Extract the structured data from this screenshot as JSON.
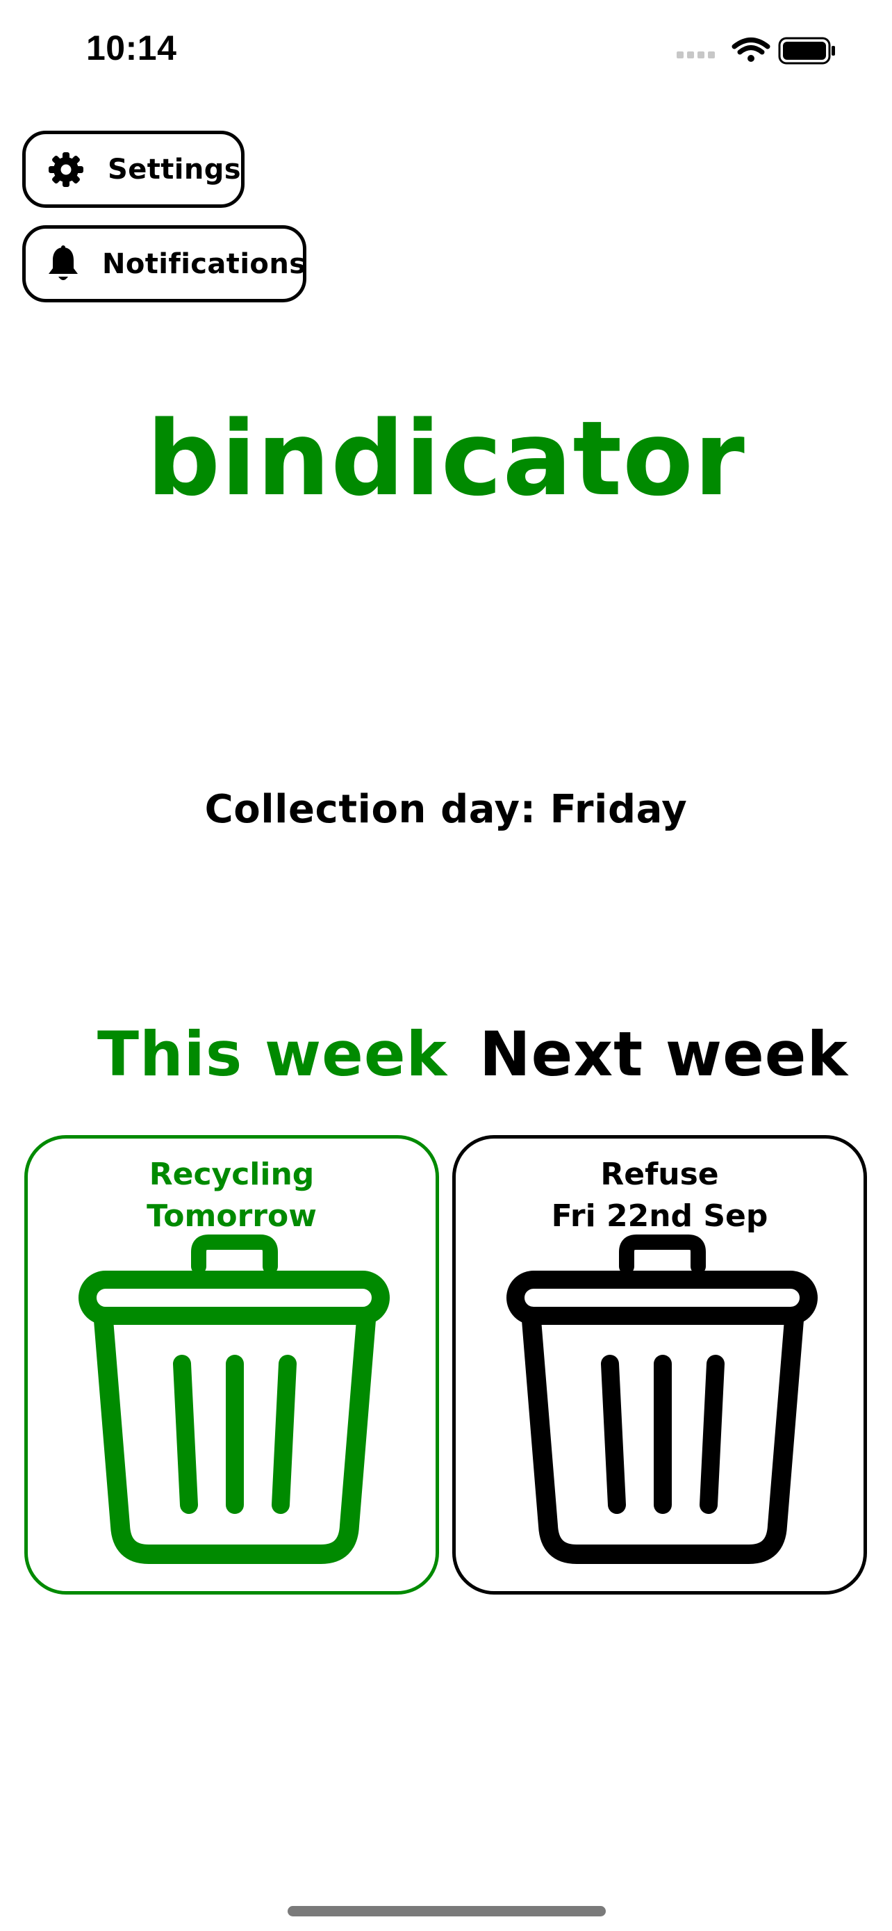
{
  "status_bar": {
    "time": "10:14",
    "icons": [
      "signal-icon",
      "wifi-icon",
      "battery-icon"
    ]
  },
  "buttons": {
    "settings": {
      "label": "Settings",
      "icon": "gear-icon"
    },
    "notifications": {
      "label": "Notifications",
      "icon": "bell-icon"
    }
  },
  "app": {
    "title": "bindicator",
    "collection_day": "Collection day: Friday"
  },
  "weeks": {
    "this_week": {
      "heading": "This week",
      "bin_type": "Recycling",
      "when": "Tomorrow",
      "icon": "trash-bin-icon",
      "color": "#008a00"
    },
    "next_week": {
      "heading": "Next week",
      "bin_type": "Refuse",
      "when": "Fri 22nd Sep",
      "icon": "trash-bin-icon",
      "color": "#000000"
    }
  },
  "colors": {
    "accent": "#008a00",
    "text": "#000000",
    "background": "#ffffff"
  }
}
